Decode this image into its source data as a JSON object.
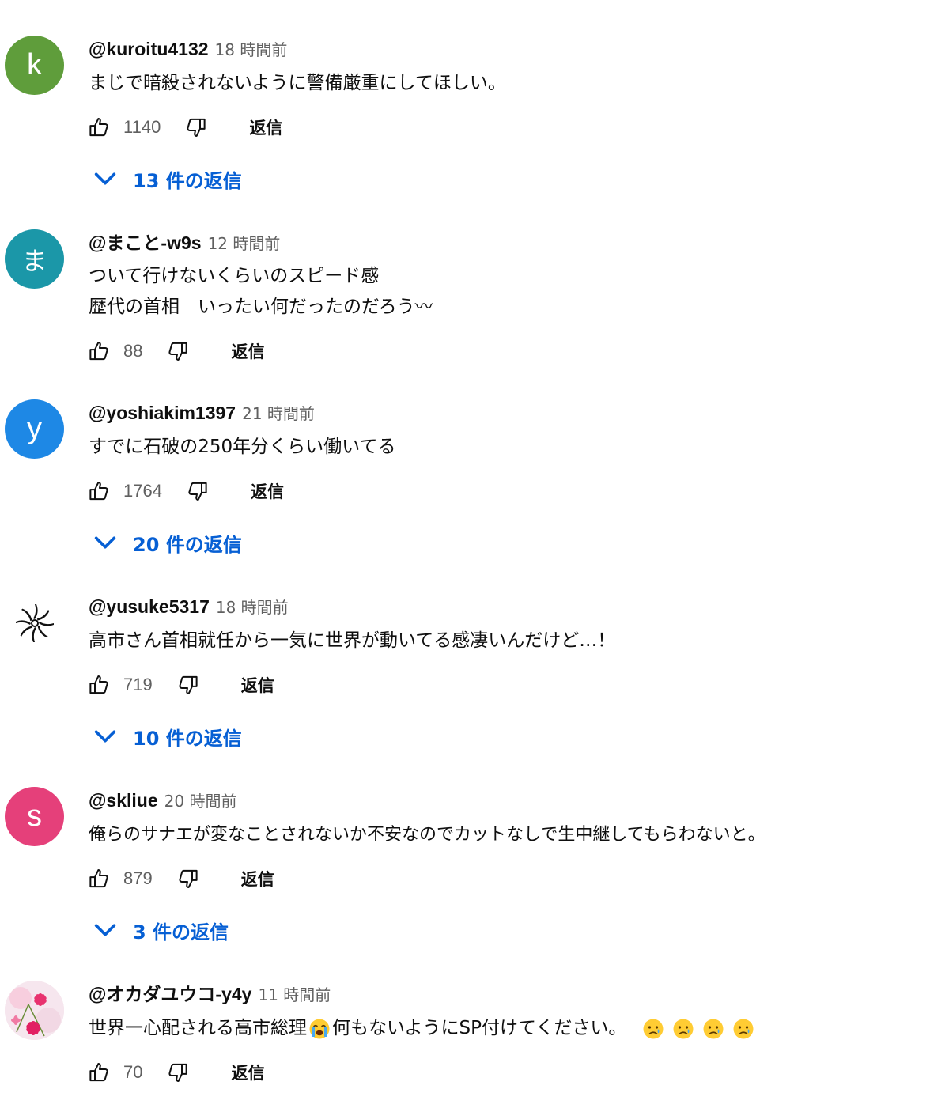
{
  "comments": [
    {
      "avatar_letter": "k",
      "avatar_color": "#5f9d3b",
      "author": "@kuroitu4132",
      "time": "18 時間前",
      "lines": [
        "まじで暗殺されないように警備厳重にしてほしい。"
      ],
      "likes": "1140",
      "reply_label": "返信",
      "replies_label": "13 件の返信"
    },
    {
      "avatar_letter": "ま",
      "avatar_color": "#1b97a8",
      "author": "@まこと-w9s",
      "time": "12 時間前",
      "lines": [
        "ついて行けないくらいのスピード感",
        "歴代の首相　いったい何だったのだろう〰"
      ],
      "likes": "88",
      "reply_label": "返信"
    },
    {
      "avatar_letter": "y",
      "avatar_color": "#1e88e5",
      "author": "@yoshiakim1397",
      "time": "21 時間前",
      "lines": [
        "すでに石破の250年分くらい働いてる"
      ],
      "likes": "1764",
      "reply_label": "返信",
      "replies_label": "20 件の返信"
    },
    {
      "avatar_icon": "pinwheel-icon",
      "author": "@yusuke5317",
      "time": "18 時間前",
      "lines": [
        "高市さん首相就任から一気に世界が動いてる感凄いんだけど…！"
      ],
      "likes": "719",
      "reply_label": "返信",
      "replies_label": "10 件の返信"
    },
    {
      "avatar_letter": "s",
      "avatar_color": "#e5407a",
      "author": "@skliue",
      "time": "20 時間前",
      "lines": [
        "俺らのサナエが変なことされないか不安なのでカットなしで生中継してもらわないと。"
      ],
      "likes": "879",
      "reply_label": "返信",
      "replies_label": "3 件の返信"
    },
    {
      "avatar_icon": "flower-photo-icon",
      "author": "@オカダユウコ-y4y",
      "time": "11 時間前",
      "text_before_emoji": "世界一心配される高市総理",
      "text_after_emoji": "何もないようにSP付けてください。",
      "emoji_icons": [
        "loudly-crying-emoji",
        "sad-tear-emoji"
      ],
      "likes": "70",
      "reply_label": "返信"
    }
  ],
  "colors": {
    "link_blue": "#065fd4",
    "secondary_text": "#606060"
  }
}
